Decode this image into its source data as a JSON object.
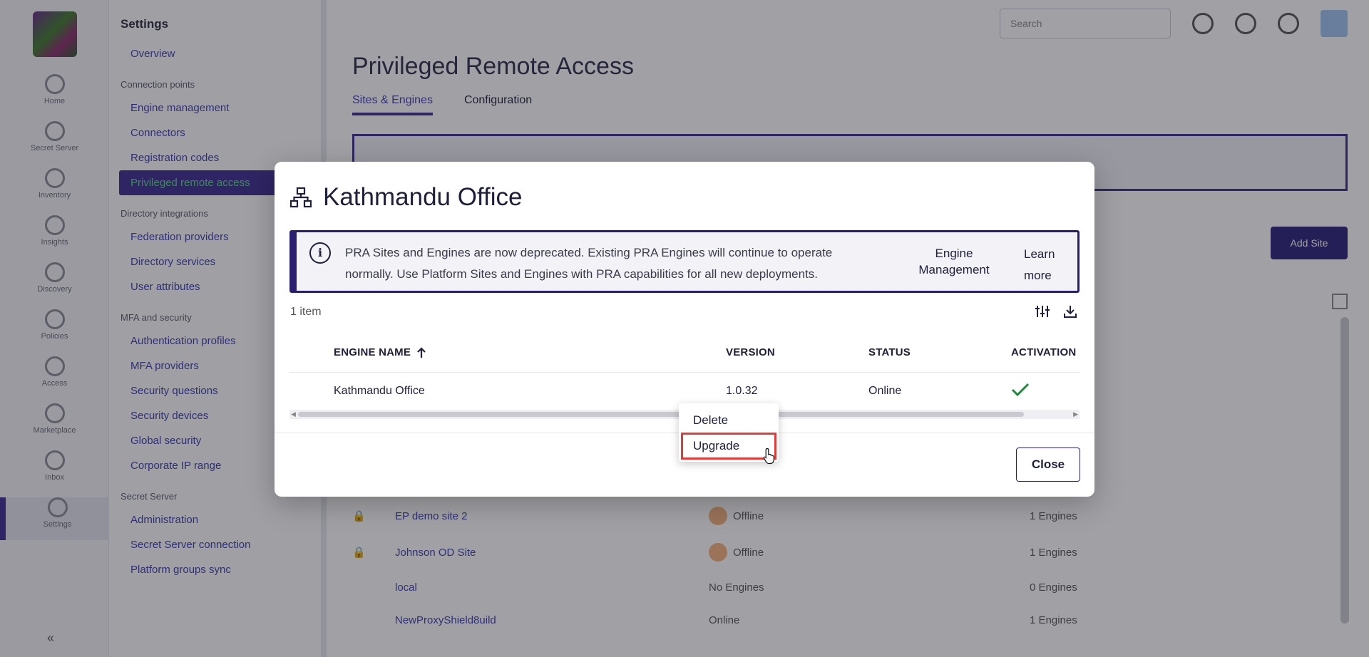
{
  "rail": {
    "items": [
      "Home",
      "Secret Server",
      "Inventory",
      "Insights",
      "Discovery",
      "Policies",
      "Access",
      "Marketplace",
      "Inbox",
      "Settings"
    ],
    "collapse_label": "«"
  },
  "nav": {
    "title": "Settings",
    "overview": "Overview",
    "sections": [
      {
        "title": "Connection points",
        "items": [
          "Engine management",
          "Connectors",
          "Registration codes",
          "Privileged remote access"
        ]
      },
      {
        "title": "Directory integrations",
        "items": [
          "Federation providers",
          "Directory services",
          "User attributes"
        ]
      },
      {
        "title": "MFA and security",
        "items": [
          "Authentication profiles",
          "MFA providers",
          "Security questions",
          "Security devices",
          "Global security",
          "Corporate IP range"
        ]
      },
      {
        "title": "Secret Server",
        "items": [
          "Administration",
          "Secret Server connection",
          "Platform groups sync"
        ]
      }
    ]
  },
  "topbar": {
    "search_placeholder": "Search"
  },
  "page": {
    "title": "Privileged Remote Access",
    "tabs": [
      "Sites & Engines",
      "Configuration"
    ],
    "add_button": "Add Site",
    "rows": [
      {
        "name": "EP demo site 2",
        "status": "Offline",
        "engines": "1 Engines"
      },
      {
        "name": "Johnson OD Site",
        "status": "Offline",
        "engines": "1 Engines"
      },
      {
        "name": "local",
        "status": "No Engines",
        "engines": "0 Engines"
      },
      {
        "name": "NewProxyShield8uild",
        "status": "Online",
        "engines": "1 Engines"
      }
    ]
  },
  "modal": {
    "title": "Kathmandu Office",
    "notice": {
      "message": "PRA Sites and Engines are now deprecated. Existing PRA Engines will continue to operate normally. Use Platform Sites and Engines with PRA capabilities for all new deployments.",
      "link_engine": "Engine Management",
      "link_learn": "Learn more"
    },
    "item_count": "1 item",
    "table": {
      "headers": {
        "name": "ENGINE NAME",
        "version": "VERSION",
        "status": "STATUS",
        "activation": "ACTIVATION"
      },
      "rows": [
        {
          "name": "Kathmandu Office",
          "version": "1.0.32",
          "status": "Online",
          "activated": true
        }
      ]
    },
    "close_label": "Close"
  },
  "context_menu": {
    "items": [
      "Delete",
      "Upgrade"
    ],
    "highlighted": "Upgrade"
  },
  "colors": {
    "accent": "#2a1f6e",
    "success": "#1f8a3a",
    "highlight": "#e03b3b"
  }
}
